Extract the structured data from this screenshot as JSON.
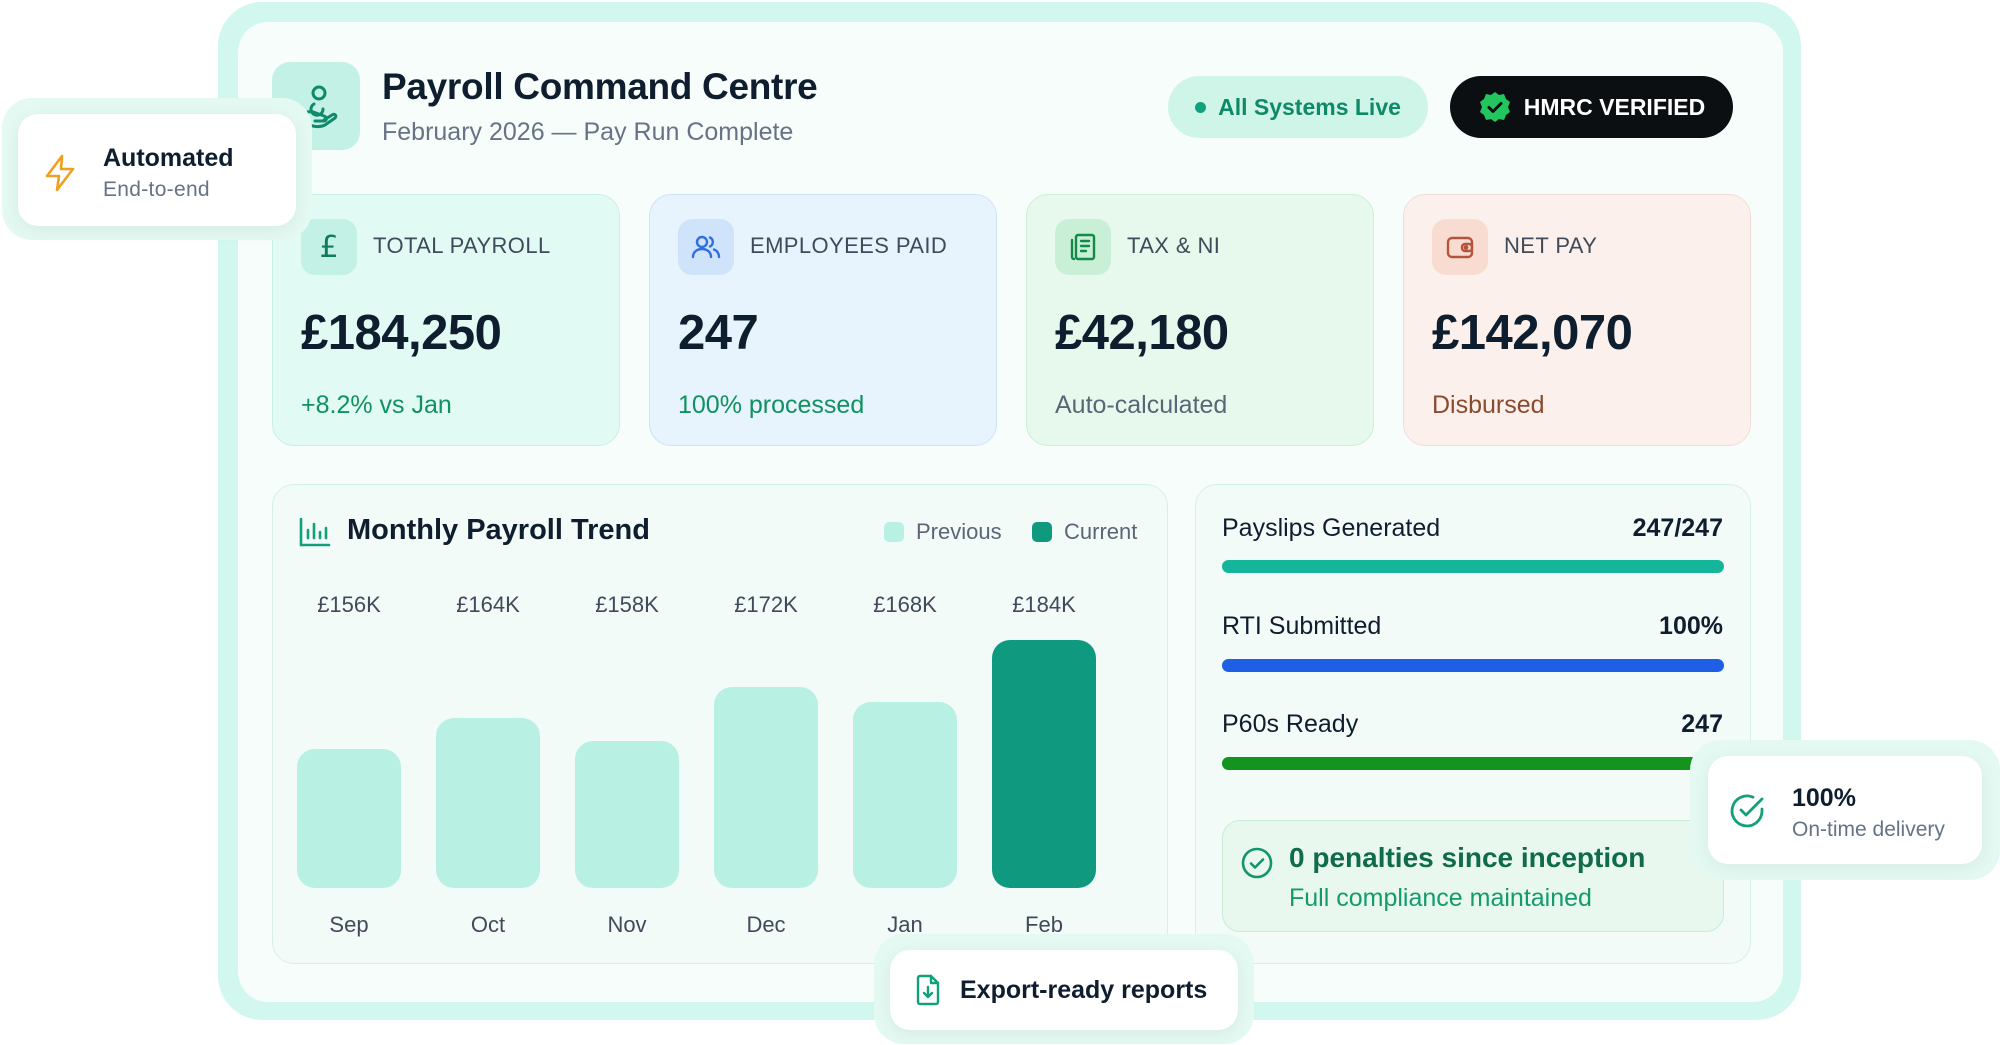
{
  "header": {
    "title": "Payroll Command Centre",
    "subtitle": "February 2026 — Pay Run Complete",
    "status_pill": "All Systems Live",
    "verified_pill": "HMRC VERIFIED"
  },
  "stats": [
    {
      "icon": "pound-icon",
      "label": "TOTAL PAYROLL",
      "value": "£184,250",
      "sub": "+8.2% vs Jan",
      "sub_color": "#11915f",
      "accent": "#c4f1e6"
    },
    {
      "icon": "users-icon",
      "label": "EMPLOYEES PAID",
      "value": "247",
      "sub": "100% processed",
      "sub_color": "#11915f",
      "accent": "#cfe4fb"
    },
    {
      "icon": "document-icon",
      "label": "TAX & NI",
      "value": "£42,180",
      "sub": "Auto-calculated",
      "sub_color": "#5a6676",
      "accent": "#c9f0d6"
    },
    {
      "icon": "wallet-icon",
      "label": "NET PAY",
      "value": "£142,070",
      "sub": "Disbursed",
      "sub_color": "#8a4a2e",
      "accent": "#f8dcd2"
    }
  ],
  "chart": {
    "title": "Monthly Payroll Trend",
    "legend_previous": "Previous",
    "legend_current": "Current",
    "colors": {
      "previous": "#b8f0e4",
      "current": "#0f9a80"
    }
  },
  "chart_data": {
    "type": "bar",
    "title": "Monthly Payroll Trend",
    "categories": [
      "Sep",
      "Oct",
      "Nov",
      "Dec",
      "Jan",
      "Feb"
    ],
    "values": [
      156,
      164,
      158,
      172,
      168,
      184
    ],
    "value_labels": [
      "£156K",
      "£164K",
      "£158K",
      "£172K",
      "£168K",
      "£184K"
    ],
    "unit": "£K",
    "highlight": "Feb",
    "series_legend": [
      "Previous",
      "Current"
    ],
    "legend_position": "top-right",
    "grid": false
  },
  "progress": [
    {
      "label": "Payslips Generated",
      "value": "247/247",
      "fraction": 1.0,
      "color": "#15b59b"
    },
    {
      "label": "RTI Submitted",
      "value": "100%",
      "fraction": 1.0,
      "color": "#1f5fe6"
    },
    {
      "label": "P60s Ready",
      "value": "247",
      "fraction": 1.0,
      "color": "#12941e"
    }
  ],
  "compliance": {
    "title": "0 penalties since inception",
    "subtitle": "Full compliance maintained"
  },
  "floating": {
    "automated_title": "Automated",
    "automated_sub": "End-to-end",
    "delivery_title": "100%",
    "delivery_sub": "On-time delivery",
    "export_title": "Export-ready reports"
  }
}
